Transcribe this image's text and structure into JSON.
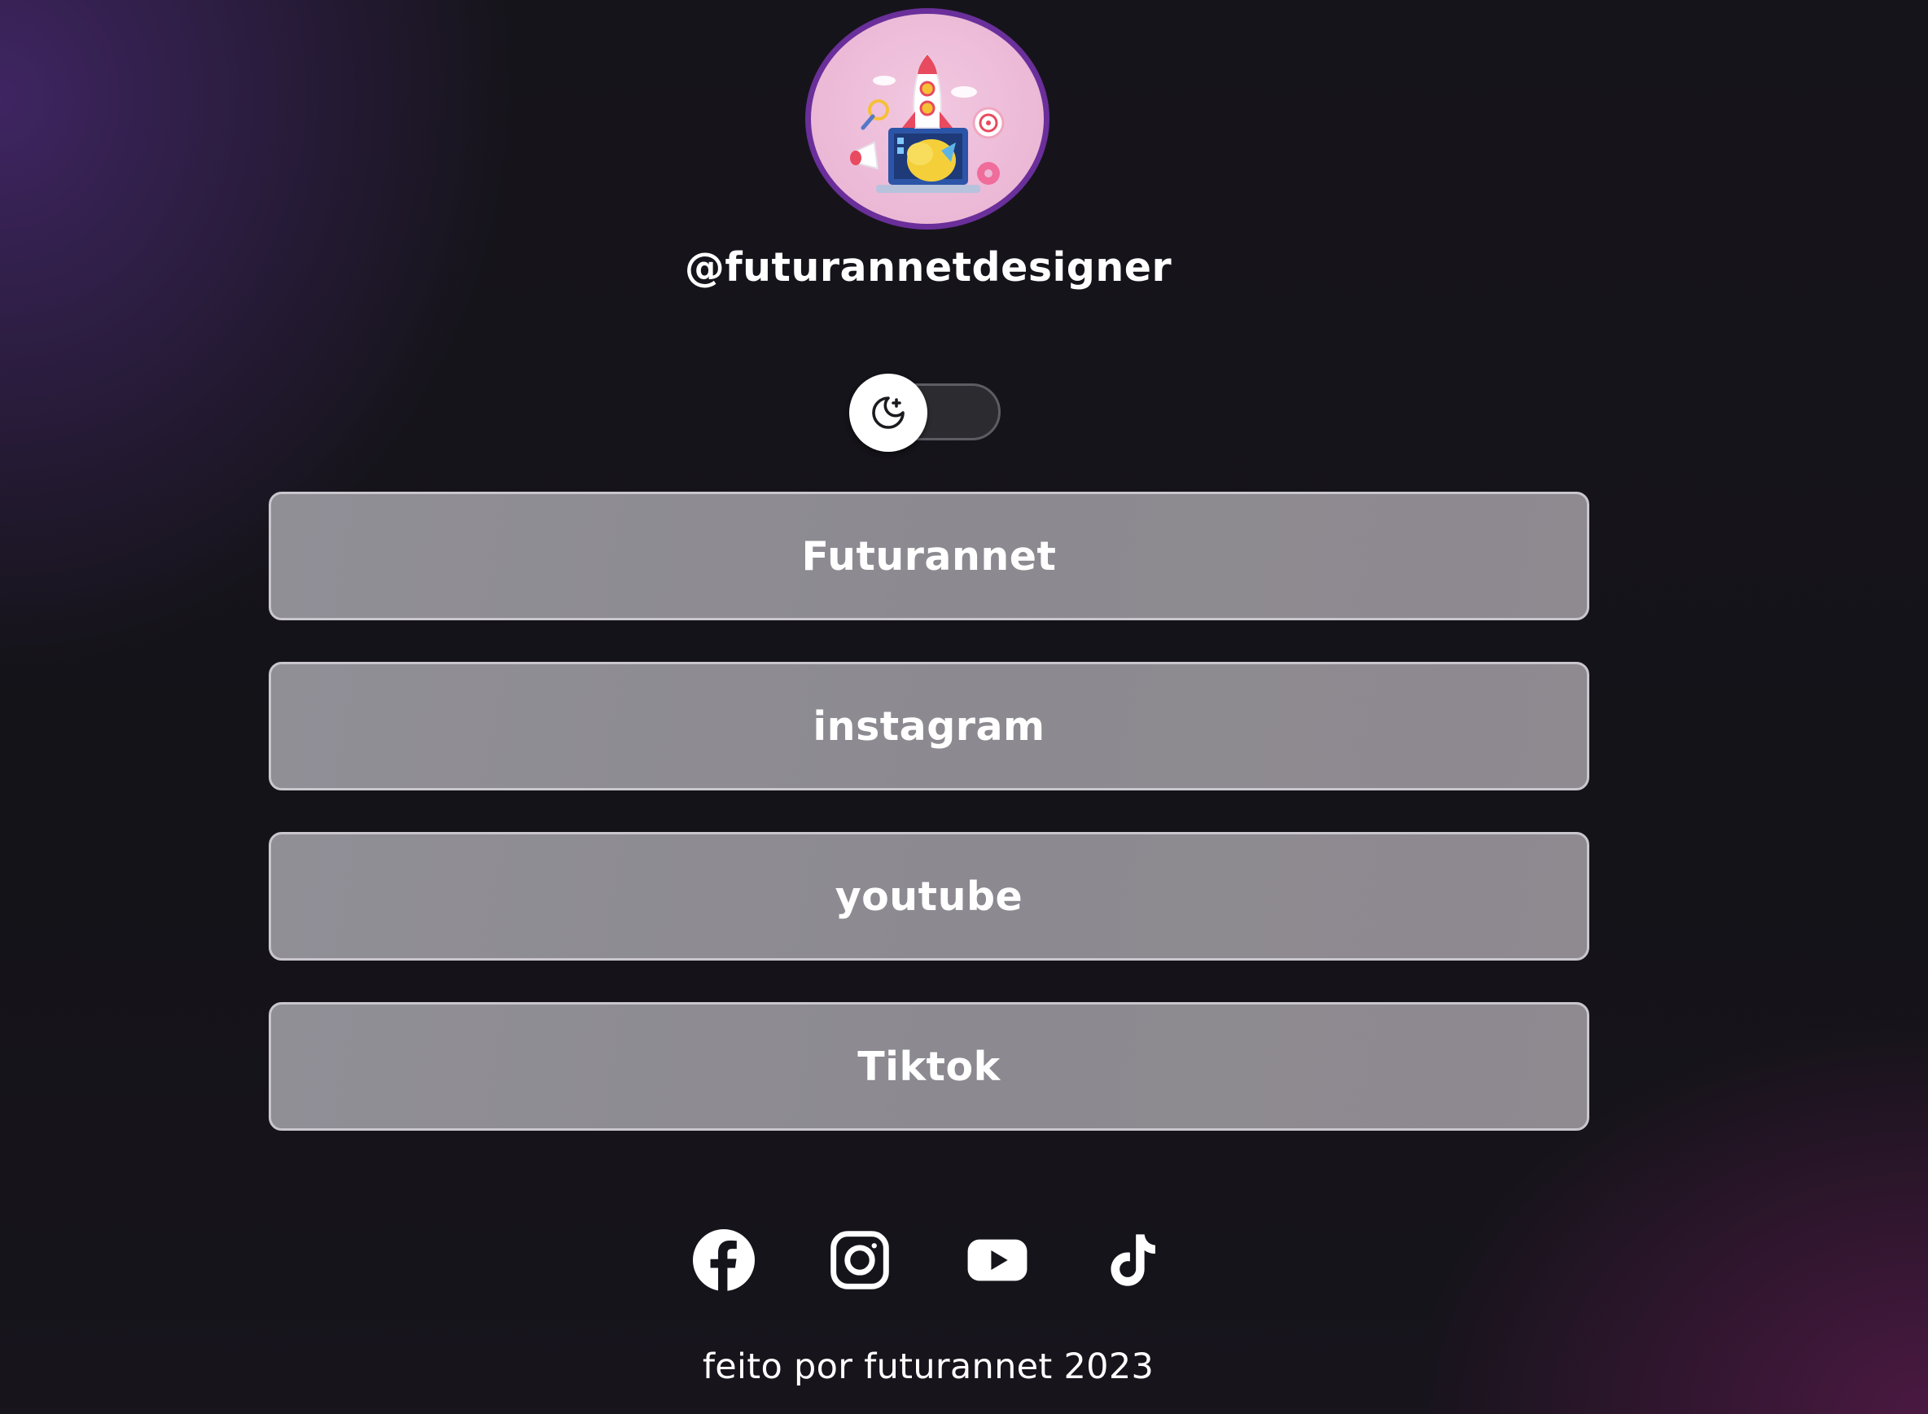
{
  "profile": {
    "username": "@futurannetdesigner",
    "avatar_icon": "rocket-illustration-icon"
  },
  "theme_toggle": {
    "icon": "moon-stars-icon",
    "state": "dark"
  },
  "links": [
    {
      "label": "Futurannet"
    },
    {
      "label": "instagram"
    },
    {
      "label": "youtube"
    },
    {
      "label": "Tiktok"
    }
  ],
  "socials": [
    {
      "icon": "facebook-icon"
    },
    {
      "icon": "instagram-icon"
    },
    {
      "icon": "youtube-icon"
    },
    {
      "icon": "tiktok-icon"
    }
  ],
  "footer": {
    "text": "feito por futurannet 2023"
  },
  "colors": {
    "avatar_border": "#6a2f9a",
    "button_fill": "#8e8c92",
    "button_border": "#c9c7cd",
    "text": "#ffffff"
  }
}
